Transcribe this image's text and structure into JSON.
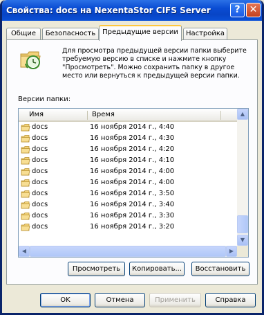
{
  "window": {
    "title": "Свойства: docs на NexentaStor CIFS Server (docs...",
    "help_button": "?",
    "close_button": "✕"
  },
  "tabs": [
    {
      "label": "Общие"
    },
    {
      "label": "Безопасность"
    },
    {
      "label": "Предыдущие версии",
      "active": true
    },
    {
      "label": "Настройка"
    }
  ],
  "description": "Для просмотра предыдущей версии папки выберите требуемую версию в списке и нажмите кнопку \"Просмотреть\".  Можно сохранить папку в другое место или вернуться к предыдущей версии папки.",
  "list": {
    "caption": "Версии папки:",
    "columns": {
      "name": "Имя",
      "time": "Время"
    },
    "rows": [
      {
        "name": "docs",
        "time": "16 ноября 2014 г., 4:40"
      },
      {
        "name": "docs",
        "time": "16 ноября 2014 г., 4:30"
      },
      {
        "name": "docs",
        "time": "16 ноября 2014 г., 4:20"
      },
      {
        "name": "docs",
        "time": "16 ноября 2014 г., 4:10"
      },
      {
        "name": "docs",
        "time": "16 ноября 2014 г., 4:00"
      },
      {
        "name": "docs",
        "time": "16 ноября 2014 г., 4:00"
      },
      {
        "name": "docs",
        "time": "16 ноября 2014 г., 3:50"
      },
      {
        "name": "docs",
        "time": "16 ноября 2014 г., 3:40"
      },
      {
        "name": "docs",
        "time": "16 ноября 2014 г., 3:30"
      },
      {
        "name": "docs",
        "time": "16 ноября 2014 г., 3:20"
      }
    ]
  },
  "actions": {
    "view": "Просмотреть",
    "copy": "Копировать...",
    "restore": "Восстановить"
  },
  "footer": {
    "ok": "OK",
    "cancel": "Отмена",
    "apply": "Применить",
    "help": "Справка"
  },
  "colors": {
    "titlebar": "#0A4CD3",
    "dialog_bg": "#ECE9D8",
    "active_tab_accent": "#FFC73C",
    "button_border": "#003C74"
  }
}
